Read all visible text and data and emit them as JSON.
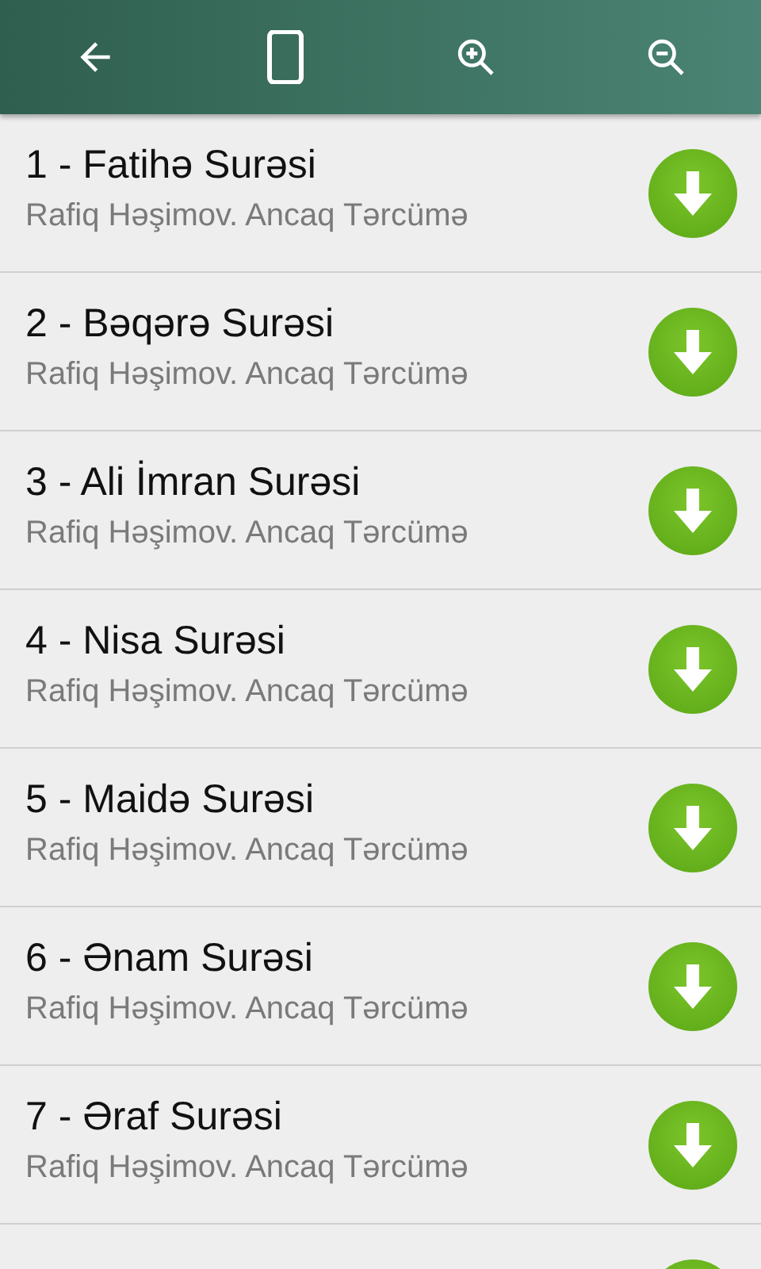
{
  "toolbar": {
    "buttons": [
      {
        "kind": "back"
      },
      {
        "kind": "phone"
      },
      {
        "kind": "zoom_in"
      },
      {
        "kind": "zoom_out"
      }
    ]
  },
  "items": [
    {
      "title": "1 - Fatihə Surəsi",
      "subtitle": "Rafiq Həşimov. Ancaq Tərcümə"
    },
    {
      "title": "2 - Bəqərə Surəsi",
      "subtitle": "Rafiq Həşimov. Ancaq Tərcümə"
    },
    {
      "title": "3 - Ali İmran Surəsi",
      "subtitle": "Rafiq Həşimov. Ancaq Tərcümə"
    },
    {
      "title": "4 - Nisa Surəsi",
      "subtitle": "Rafiq Həşimov. Ancaq Tərcümə"
    },
    {
      "title": "5 - Maidə Surəsi",
      "subtitle": "Rafiq Həşimov. Ancaq Tərcümə"
    },
    {
      "title": "6 - Ənam Surəsi",
      "subtitle": "Rafiq Həşimov. Ancaq Tərcümə"
    },
    {
      "title": "7 - Əraf Surəsi",
      "subtitle": "Rafiq Həşimov. Ancaq Tərcümə"
    }
  ],
  "more_below": true
}
